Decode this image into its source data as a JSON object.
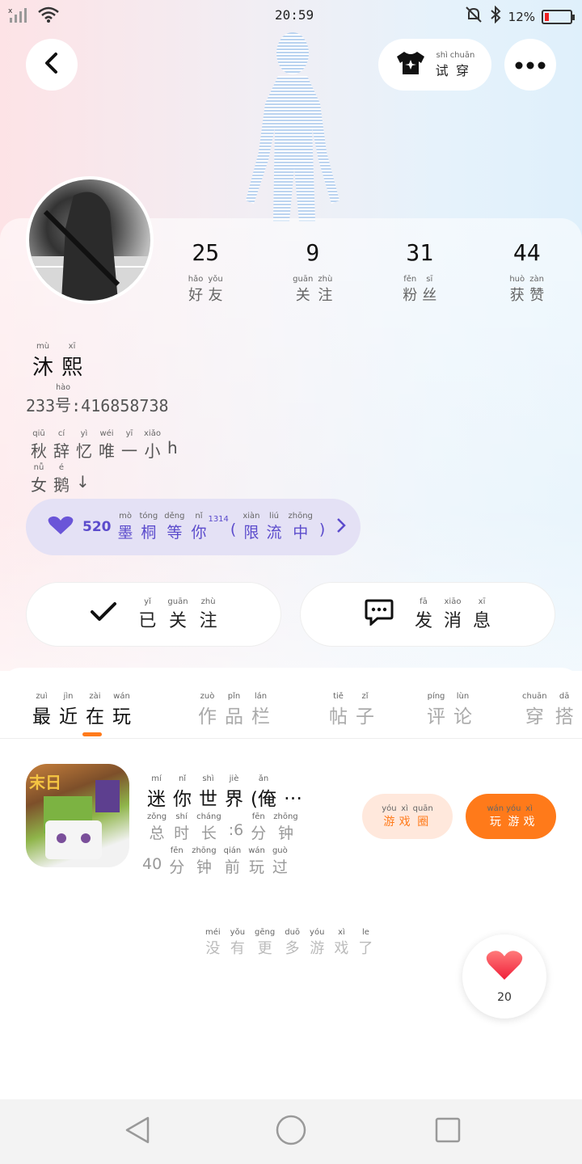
{
  "status_bar": {
    "time": "20:59",
    "battery": "12%"
  },
  "header": {
    "try_on": {
      "chars": [
        [
          "试",
          "shì"
        ],
        [
          "穿",
          "chuān"
        ]
      ]
    }
  },
  "stats": [
    {
      "value": "25",
      "label": [
        [
          "好",
          "hǎo"
        ],
        [
          "友",
          "yǒu"
        ]
      ]
    },
    {
      "value": "9",
      "label": [
        [
          "关",
          "guān"
        ],
        [
          "注",
          "zhù"
        ]
      ]
    },
    {
      "value": "31",
      "label": [
        [
          "粉",
          "fěn"
        ],
        [
          "丝",
          "sī"
        ]
      ]
    },
    {
      "value": "44",
      "label": [
        [
          "获",
          "huò"
        ],
        [
          "赞",
          "zàn"
        ]
      ]
    }
  ],
  "profile": {
    "name": [
      [
        "沐",
        "mù"
      ],
      [
        "熙",
        "xī"
      ]
    ],
    "id_prefix": "233",
    "id_hao": [
      [
        "号",
        "hào"
      ]
    ],
    "id_value": ":416858738",
    "bio_line1": [
      [
        "秋",
        "qiū"
      ],
      [
        "辞",
        "cí"
      ],
      [
        "忆",
        "yì"
      ],
      [
        "唯",
        "wéi"
      ],
      [
        "一",
        "yī"
      ],
      [
        "小",
        "xiǎo"
      ],
      [
        "h",
        ""
      ]
    ],
    "bio_line2": [
      [
        "女",
        "nǚ"
      ],
      [
        "鹅",
        "é"
      ],
      [
        "↓",
        ""
      ]
    ]
  },
  "music": {
    "prefix": "520",
    "title": [
      [
        "墨",
        "mò"
      ],
      [
        "桐",
        "tóng"
      ],
      [
        "等",
        "děng"
      ],
      [
        "你",
        "nǐ"
      ]
    ],
    "mid": "1314",
    "tail": [
      [
        "(",
        ""
      ],
      [
        "限",
        "xiàn"
      ],
      [
        "流",
        "liú"
      ],
      [
        "中",
        "zhōng"
      ],
      [
        ")",
        ""
      ]
    ]
  },
  "actions": {
    "followed": [
      [
        "已",
        "yǐ"
      ],
      [
        "关",
        "guān"
      ],
      [
        "注",
        "zhù"
      ]
    ],
    "message": [
      [
        "发",
        "fā"
      ],
      [
        "消",
        "xiāo"
      ],
      [
        "息",
        "xī"
      ]
    ]
  },
  "tabs": [
    {
      "chars": [
        [
          "最",
          "zuì"
        ],
        [
          "近",
          "jìn"
        ],
        [
          "在",
          "zài"
        ],
        [
          "玩",
          "wán"
        ]
      ],
      "active": true
    },
    {
      "chars": [
        [
          "作",
          "zuò"
        ],
        [
          "品",
          "pǐn"
        ],
        [
          "栏",
          "lán"
        ]
      ],
      "active": false
    },
    {
      "chars": [
        [
          "帖",
          "tiě"
        ],
        [
          "子",
          "zǐ"
        ]
      ],
      "active": false
    },
    {
      "chars": [
        [
          "评",
          "píng"
        ],
        [
          "论",
          "lùn"
        ]
      ],
      "active": false
    },
    {
      "chars": [
        [
          "穿",
          "chuān"
        ],
        [
          "搭",
          "dā"
        ]
      ],
      "active": false
    }
  ],
  "game": {
    "title": [
      [
        "迷",
        "mí"
      ],
      [
        "你",
        "nǐ"
      ],
      [
        "世",
        "shì"
      ],
      [
        "界",
        "jiè"
      ],
      [
        "(俺",
        "ǎn"
      ],
      [
        "…",
        ""
      ]
    ],
    "duration": [
      [
        "总",
        "zǒng"
      ],
      [
        "时",
        "shí"
      ],
      [
        "长",
        "cháng"
      ],
      [
        ":6",
        ""
      ],
      [
        "分",
        "fēn"
      ],
      [
        "钟",
        "zhōng"
      ]
    ],
    "last_played": [
      [
        "40",
        ""
      ],
      [
        "分",
        "fēn"
      ],
      [
        "钟",
        "zhōng"
      ],
      [
        "前",
        "qián"
      ],
      [
        "玩",
        "wán"
      ],
      [
        "过",
        "guò"
      ]
    ],
    "circle_btn": [
      [
        "游",
        "yóu"
      ],
      [
        "戏",
        "xì"
      ],
      [
        "圈",
        "quān"
      ]
    ],
    "play_btn": [
      [
        "玩",
        "wán"
      ],
      [
        "游",
        "yóu"
      ],
      [
        "戏",
        "xì"
      ]
    ]
  },
  "empty_text": [
    [
      "没",
      "méi"
    ],
    [
      "有",
      "yǒu"
    ],
    [
      "更",
      "gēng"
    ],
    [
      "多",
      "duō"
    ],
    [
      "游",
      "yóu"
    ],
    [
      "戏",
      "xì"
    ],
    [
      "了",
      "le"
    ]
  ],
  "likes": {
    "count": "20"
  },
  "icons": {
    "back": "back-arrow-icon",
    "more": "more-icon",
    "shirt": "shirt-icon",
    "heart": "heart-icon",
    "check": "check-icon",
    "chat": "chat-icon"
  },
  "colors": {
    "accent": "#ff7a1a",
    "music_bg": "#e4e1f5",
    "music_text": "#5b4bcc",
    "battery_low": "#e22222"
  }
}
